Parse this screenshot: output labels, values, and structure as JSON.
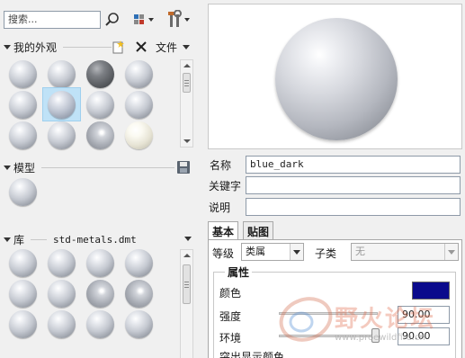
{
  "toolbar": {
    "search_placeholder": "搜索...",
    "icons": [
      "search-icon",
      "display-style-icon",
      "tools-icon"
    ]
  },
  "my_appearance": {
    "title": "我的外观",
    "file_label": "文件",
    "rows": 3,
    "cols": 4,
    "selected_index": 5
  },
  "model": {
    "title": "模型"
  },
  "library": {
    "title": "库",
    "file": "std-metals.dmt"
  },
  "properties": {
    "name_label": "名称",
    "name_value": "blue_dark",
    "keyword_label": "关键字",
    "keyword_value": "",
    "desc_label": "说明",
    "desc_value": ""
  },
  "tabs": [
    {
      "label": "基本",
      "active": true
    },
    {
      "label": "贴图",
      "active": false
    }
  ],
  "basic": {
    "class_label": "等级",
    "class_value": "类属",
    "subclass_label": "子类",
    "subclass_value": "无",
    "group_title": "属性",
    "color_label": "颜色",
    "color_value": "#0a0a8c",
    "intensity_label": "强度",
    "intensity_value": "90.00",
    "ambient_label": "环境",
    "ambient_value": "90.00",
    "partial_label": "突出显示颜色"
  },
  "watermark": {
    "title": "野火论坛",
    "url": "www.proewildfire.cn"
  }
}
